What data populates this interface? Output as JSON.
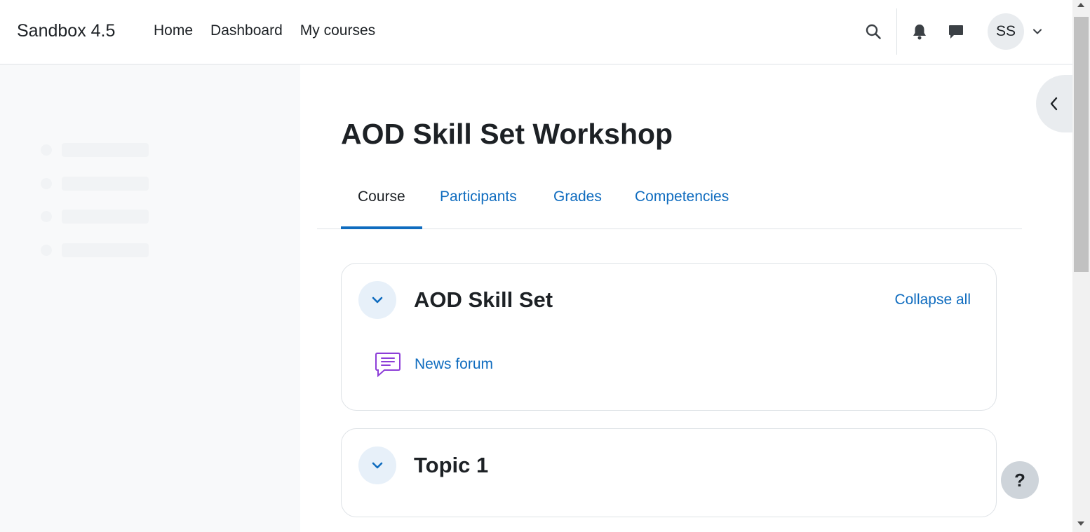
{
  "navbar": {
    "brand": "Sandbox 4.5",
    "links": [
      "Home",
      "Dashboard",
      "My courses"
    ],
    "user_initials": "SS"
  },
  "course": {
    "title": "AOD Skill Set Workshop",
    "tabs": [
      "Course",
      "Participants",
      "Grades",
      "Competencies"
    ],
    "active_tab": "Course"
  },
  "sections": [
    {
      "title": "AOD Skill Set",
      "action": "Collapse all",
      "activities": [
        {
          "name": "News forum",
          "icon": "forum-icon"
        }
      ]
    },
    {
      "title": "Topic 1"
    }
  ],
  "help": {
    "label": "?"
  },
  "colors": {
    "link": "#0f6cbf",
    "text": "#1d2125",
    "forum_icon": "#8d3ed8",
    "drawer_bg": "#f8f9fa"
  },
  "icons": {
    "search": "search-icon",
    "bell": "bell-icon",
    "chat": "chat-icon",
    "user_menu": "chevron-down-icon",
    "drawer_toggle": "chevron-left-icon",
    "section_toggle": "chevron-down-icon"
  }
}
